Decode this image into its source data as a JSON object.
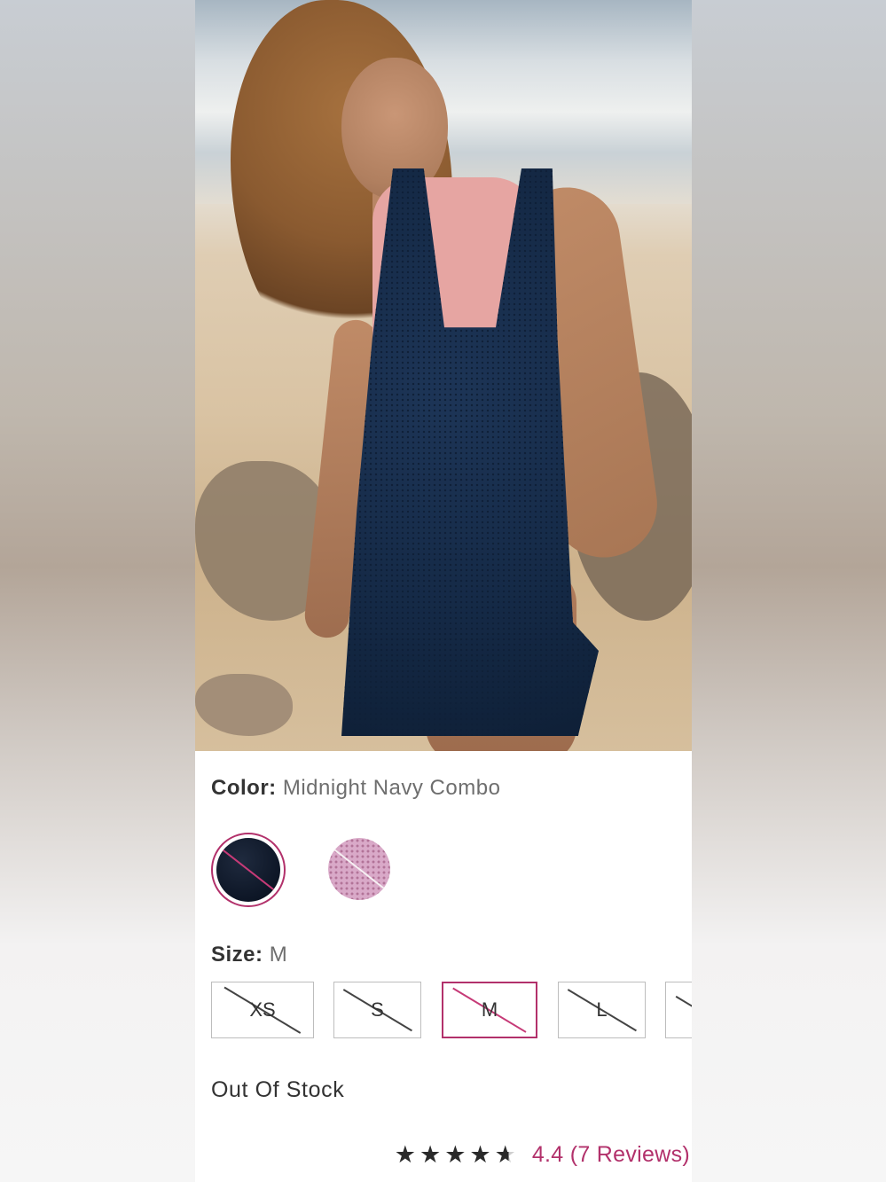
{
  "product": {
    "image_alt": "",
    "color": {
      "label": "Color:",
      "value": "Midnight Navy Combo",
      "options": [
        {
          "name": "midnight-navy",
          "hex": "#101a2c",
          "selected": true,
          "unavailable": true
        },
        {
          "name": "pink",
          "hex": "#d7a7c7",
          "selected": false,
          "unavailable": true
        }
      ]
    },
    "size": {
      "label": "Size:",
      "value": "M",
      "options": [
        {
          "label": "XS",
          "selected": false,
          "unavailable": true
        },
        {
          "label": "S",
          "selected": false,
          "unavailable": true
        },
        {
          "label": "M",
          "selected": true,
          "unavailable": true
        },
        {
          "label": "L",
          "selected": false,
          "unavailable": true
        },
        {
          "label": "",
          "selected": false,
          "unavailable": true
        }
      ]
    },
    "stock_status": "Out Of Stock",
    "rating": {
      "stars": 4.4,
      "stars_glyphs": "★★★★",
      "half_glyph": "★",
      "text": "4.4 (7 Reviews)"
    }
  },
  "colors": {
    "accent": "#b2316b",
    "text": "#333333",
    "muted": "#6e6e6e"
  }
}
